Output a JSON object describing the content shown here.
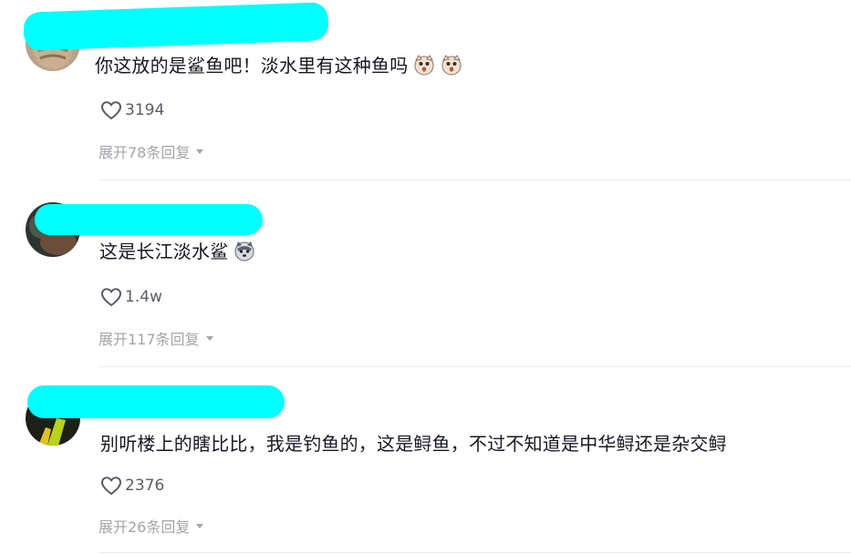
{
  "comments": [
    {
      "text": "你这放的是鲨鱼吧！淡水里有这种鱼吗",
      "emojis": [
        "cat-shocked-emoji",
        "cat-shocked-emoji"
      ],
      "likes": "3194",
      "replies_label": "展开78条回复"
    },
    {
      "text": "这是长江淡水鲨",
      "emojis": [
        "husky-emoji"
      ],
      "likes": "1.4w",
      "replies_label": "展开117条回复"
    },
    {
      "text": "别听楼上的瞎比比，我是钓鱼的，这是鲟鱼，不过不知道是中华鲟还是杂交鲟",
      "emojis": [],
      "likes": "2376",
      "replies_label": "展开26条回复"
    }
  ],
  "colors": {
    "redaction": "#00ffff",
    "text": "#161823",
    "muted": "#a3a4aa",
    "like": "#5b5d66",
    "divider": "#ececec"
  },
  "icons": {
    "like": "heart-outline-icon",
    "expand": "caret-down-icon"
  }
}
